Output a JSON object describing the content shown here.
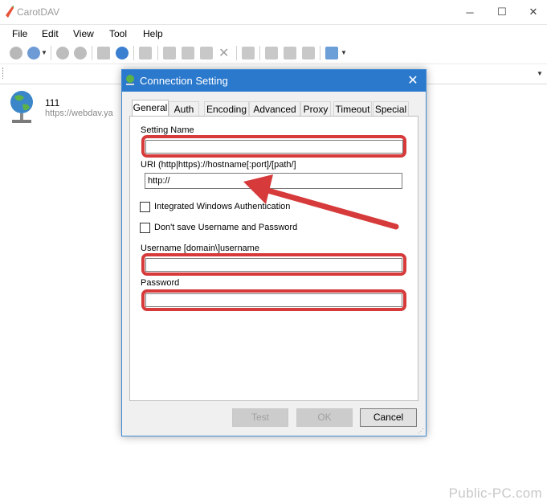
{
  "app": {
    "title": "CarotDAV",
    "window_controls": [
      "─",
      "☐",
      "✕"
    ]
  },
  "menu": [
    "File",
    "Edit",
    "View",
    "Tool",
    "Help"
  ],
  "file_list": {
    "item_name": "111",
    "item_url": "https://webdav.ya"
  },
  "dialog": {
    "title": "Connection Setting",
    "close_glyph": "✕",
    "tabs": [
      "General",
      "Auth",
      "Encoding",
      "Advanced",
      "Proxy",
      "Timeout",
      "Special"
    ],
    "active_tab": "General",
    "setting_name_label": "Setting Name",
    "setting_name_value": "",
    "uri_label": "URI  (http|https)://hostname[:port]/[path/]",
    "uri_value": "http://",
    "integrated_auth_label": "Integrated Windows Authentication",
    "integrated_auth_checked": false,
    "dont_save_label": "Don't save Username and Password",
    "dont_save_checked": false,
    "username_label": "Username  [domain\\]username",
    "username_value": "",
    "password_label": "Password",
    "password_value": "",
    "buttons": {
      "test": "Test",
      "ok": "OK",
      "cancel": "Cancel"
    }
  },
  "annotation_color": "#d63a3a",
  "accent_color": "#2b79cc",
  "watermark": "Public-PC.com"
}
